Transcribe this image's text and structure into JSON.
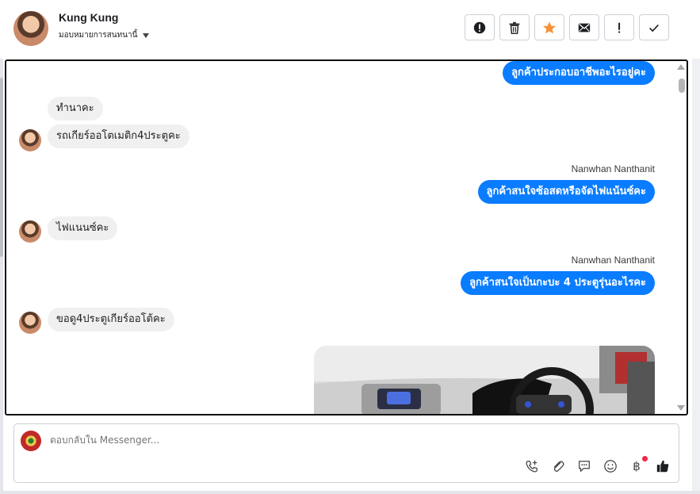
{
  "header": {
    "contact_name": "Kung Kung",
    "assign_label": "มอบหมายการสนทนานี้",
    "actions": [
      "mark-spam-icon",
      "trash-icon",
      "star-icon",
      "envelope-icon",
      "exclamation-icon",
      "checkmark-icon"
    ],
    "star_color": "#f7923a"
  },
  "conversation": {
    "messages": [
      {
        "dir": "out",
        "text": "ลูกค้าประกอบอาชีพอะไรอยู่คะ"
      },
      {
        "dir": "in",
        "text": "ทำนาคะ"
      },
      {
        "dir": "in",
        "text": "รถเกียร์ออโตเมติก4ประตูคะ"
      },
      {
        "dir": "out",
        "sender": "Nanwhan Nanthanit",
        "text": "ลูกค้าสนใจซ้อสดหรือจัดไฟแน้นซ์คะ"
      },
      {
        "dir": "in",
        "text": "ไฟแนนซ์คะ"
      },
      {
        "dir": "out",
        "sender": "Nanwhan Nanthanit",
        "text": "ลูกค้าสนใจเป็นกะบะ 4 ประตูรุ่นอะไรคะ"
      },
      {
        "dir": "in",
        "text": "ขอดู4ประตูเกียร์ออโต้คะ"
      }
    ],
    "outgoing_color": "#0a7cff"
  },
  "composer": {
    "placeholder": "ตอบกลับใน Messenger...",
    "tools": [
      "call-add-icon",
      "attachment-icon",
      "chat-bubble-icon",
      "emoji-icon",
      "baht-icon",
      "thumbs-up-icon"
    ],
    "baht_symbol": "฿"
  }
}
